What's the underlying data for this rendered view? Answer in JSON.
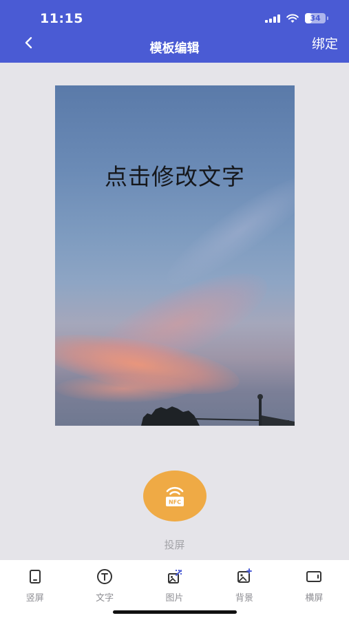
{
  "status_bar": {
    "time": "11:15",
    "battery": "34"
  },
  "nav": {
    "title": "模板编辑",
    "right_action": "绑定"
  },
  "canvas": {
    "text": "点击修改文字"
  },
  "cast": {
    "badge": "NFC",
    "label": "投屏"
  },
  "toolbar": {
    "items": [
      {
        "label": "竖屏",
        "icon": "portrait-icon"
      },
      {
        "label": "文字",
        "icon": "text-icon"
      },
      {
        "label": "图片",
        "icon": "image-edit-icon"
      },
      {
        "label": "背景",
        "icon": "background-icon"
      },
      {
        "label": "横屏",
        "icon": "landscape-icon"
      }
    ]
  },
  "colors": {
    "header": "#4a5bd4",
    "nfc_button": "#efaa45",
    "page_bg": "#e5e4e9"
  }
}
